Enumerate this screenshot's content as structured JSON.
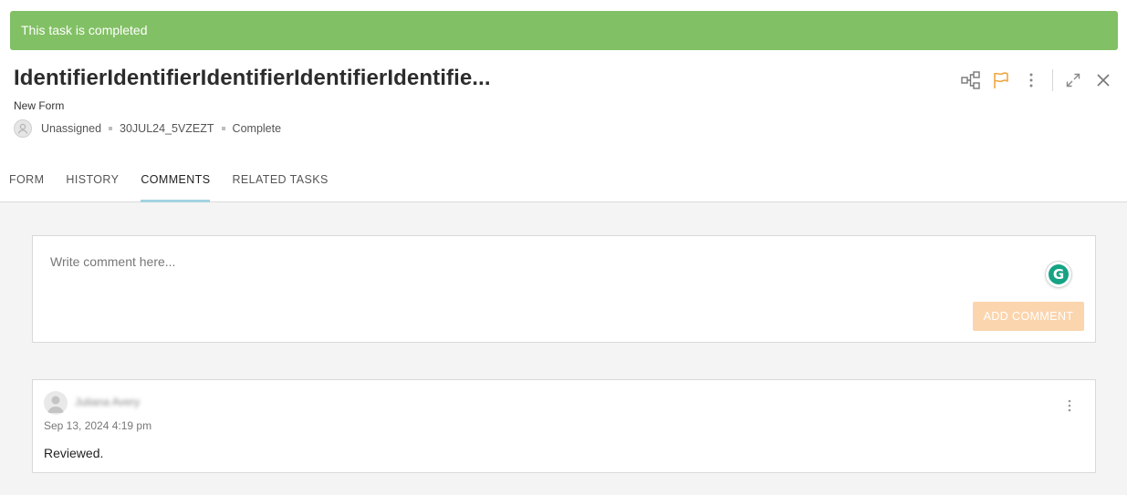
{
  "banner": {
    "text": "This task is completed",
    "color": "#82c065"
  },
  "header": {
    "title": "IdentifierIdentifierIdentifierIdentifierIdentifie...",
    "subtitle": "New Form",
    "assignee": "Unassigned",
    "task_id": "30JUL24_5VZEZT",
    "status": "Complete"
  },
  "actions": {
    "icons": [
      "workflow-icon",
      "flag-icon",
      "more-vertical-icon",
      "expand-icon",
      "close-icon"
    ],
    "flag_color": "#f0a640"
  },
  "tabs": [
    {
      "label": "FORM",
      "active": false
    },
    {
      "label": "HISTORY",
      "active": false
    },
    {
      "label": "COMMENTS",
      "active": true
    },
    {
      "label": "RELATED TASKS",
      "active": false
    }
  ],
  "comment_form": {
    "placeholder": "Write comment here...",
    "button_label": "ADD COMMENT",
    "grammarly_glyph": "G",
    "button_color": "#fbd5ae"
  },
  "comments": [
    {
      "author": "Juliana Avery",
      "date": "Sep 13, 2024 4:19 pm",
      "text": "Reviewed."
    }
  ]
}
